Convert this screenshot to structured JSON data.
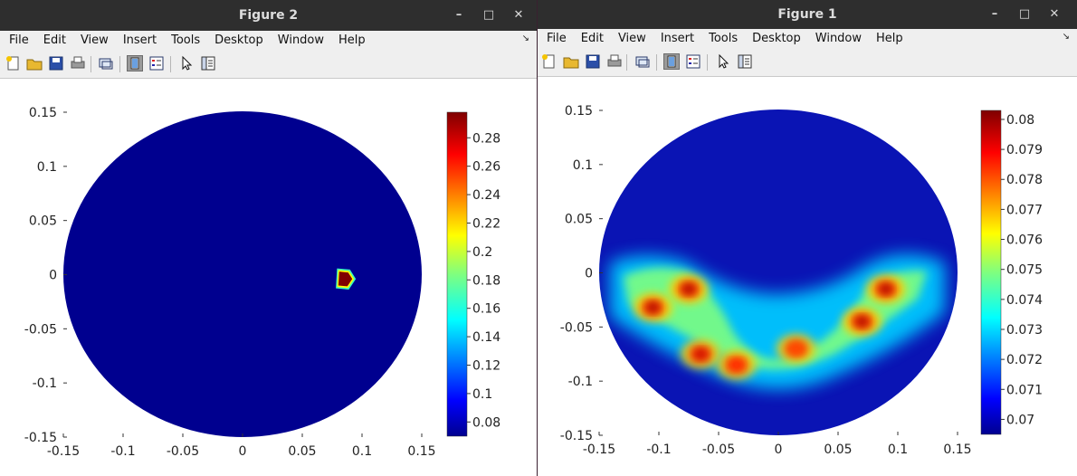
{
  "windows": [
    {
      "id": "fig2",
      "title": "Figure 2",
      "menu": [
        "File",
        "Edit",
        "View",
        "Insert",
        "Tools",
        "Desktop",
        "Window",
        "Help"
      ],
      "axes": {
        "x_ticks": [
          "-0.15",
          "-0.1",
          "-0.05",
          "0",
          "0.05",
          "0.1",
          "0.15"
        ],
        "y_ticks": [
          "0.15",
          "0.1",
          "0.05",
          "0",
          "-0.05",
          "-0.1",
          "-0.15"
        ]
      },
      "colorbar": {
        "ticks": [
          "0.28",
          "0.26",
          "0.24",
          "0.22",
          "0.2",
          "0.18",
          "0.16",
          "0.14",
          "0.12",
          "0.1",
          "0.08"
        ]
      }
    },
    {
      "id": "fig1",
      "title": "Figure 1",
      "menu": [
        "File",
        "Edit",
        "View",
        "Insert",
        "Tools",
        "Desktop",
        "Window",
        "Help"
      ],
      "axes": {
        "x_ticks": [
          "-0.15",
          "-0.1",
          "-0.05",
          "0",
          "0.05",
          "0.1",
          "0.15"
        ],
        "y_ticks": [
          "0.15",
          "0.1",
          "0.05",
          "0",
          "-0.05",
          "-0.1",
          "-0.15"
        ]
      },
      "colorbar": {
        "ticks": [
          "0.08",
          "0.079",
          "0.078",
          "0.077",
          "0.076",
          "0.075",
          "0.074",
          "0.073",
          "0.072",
          "0.071",
          "0.07"
        ]
      }
    }
  ],
  "window_controls": {
    "minimize": "–",
    "maximize": "□",
    "close": "✕"
  },
  "chart_data": [
    {
      "type": "heatmap",
      "figure": "Figure 2",
      "colormap": "jet",
      "domain": "disk of radius 0.15 centered at (0,0)",
      "xlim": [
        -0.15,
        0.15
      ],
      "ylim": [
        -0.15,
        0.15
      ],
      "clim": [
        0.07,
        0.298
      ],
      "background_value": 0.07,
      "hotspot": {
        "x": 0.085,
        "y": -0.004,
        "value": 0.298
      }
    },
    {
      "type": "heatmap",
      "figure": "Figure 1",
      "colormap": "jet",
      "domain": "disk of radius 0.15 centered at (0,0)",
      "xlim": [
        -0.15,
        0.15
      ],
      "ylim": [
        -0.15,
        0.15
      ],
      "clim": [
        0.0695,
        0.0803
      ],
      "background_value": 0.0697,
      "hotspots": [
        {
          "x": -0.105,
          "y": -0.032,
          "value": 0.0802
        },
        {
          "x": -0.075,
          "y": -0.015,
          "value": 0.0802
        },
        {
          "x": -0.065,
          "y": -0.075,
          "value": 0.0798
        },
        {
          "x": -0.035,
          "y": -0.085,
          "value": 0.0785
        },
        {
          "x": 0.015,
          "y": -0.07,
          "value": 0.078
        },
        {
          "x": 0.07,
          "y": -0.045,
          "value": 0.0802
        },
        {
          "x": 0.09,
          "y": -0.015,
          "value": 0.0802
        }
      ]
    }
  ]
}
